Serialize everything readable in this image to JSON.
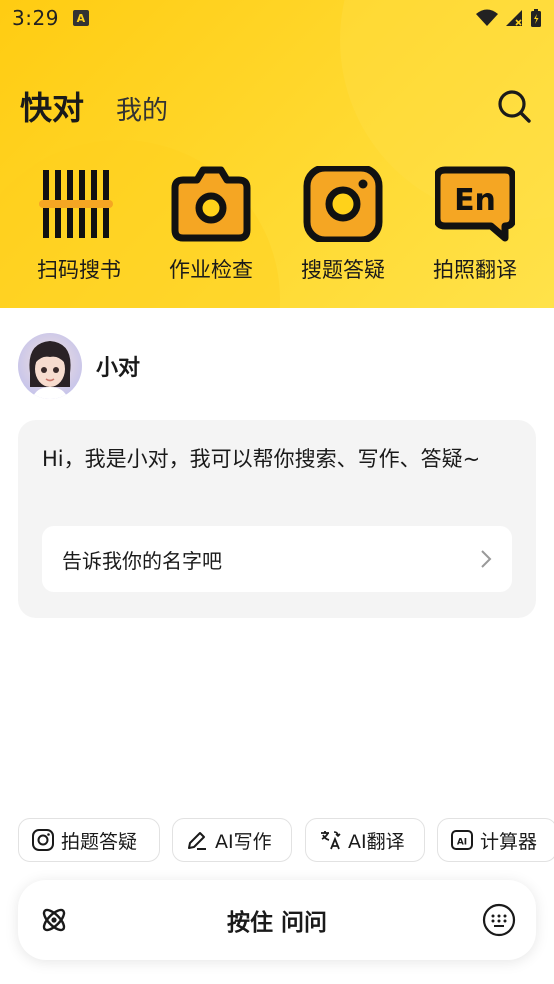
{
  "status_bar": {
    "time": "3:29",
    "notify_letter": "A"
  },
  "header": {
    "title": "快对",
    "secondary_tab": "我的"
  },
  "shortcuts": [
    {
      "label": "扫码搜书",
      "icon": "barcode-icon"
    },
    {
      "label": "作业检查",
      "icon": "camera-icon"
    },
    {
      "label": "搜题答疑",
      "icon": "instagram-camera-icon"
    },
    {
      "label": "拍照翻译",
      "icon": "en-translate-icon"
    }
  ],
  "bot": {
    "name": "小对"
  },
  "chat": {
    "message": "Hi，我是小对，我可以帮你搜索、写作、答疑~",
    "suggestion": "告诉我你的名字吧"
  },
  "tools": [
    {
      "label": "拍题答疑",
      "icon": "camera-icon"
    },
    {
      "label": "AI写作",
      "icon": "pen-icon"
    },
    {
      "label": "AI翻译",
      "icon": "translate-icon"
    },
    {
      "label": "计算器",
      "icon": "ai-box-icon"
    }
  ],
  "input_bar": {
    "hold_label": "按住 问问"
  },
  "colors": {
    "brand_yellow": "#ffd21a",
    "accent_orange": "#f5a623",
    "text": "#1a1a1a"
  }
}
